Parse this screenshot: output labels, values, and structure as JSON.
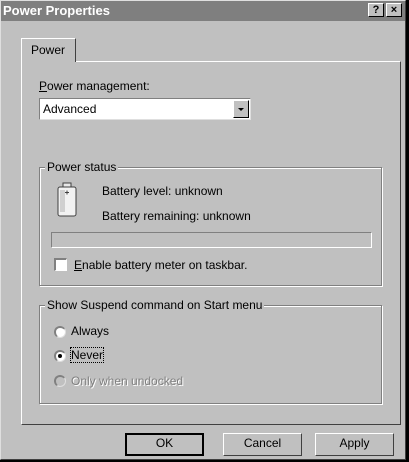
{
  "window": {
    "title": "Power Properties",
    "help_button": "?",
    "close_button": "×"
  },
  "tabs": [
    {
      "label": "Power",
      "selected": true
    }
  ],
  "power_management": {
    "label": "Power management:",
    "selected": "Advanced"
  },
  "power_status": {
    "legend": "Power status",
    "battery_level": "Battery level: unknown",
    "battery_remaining": "Battery remaining: unknown",
    "battery_meter_progress": 0,
    "enable_meter_label": "Enable battery meter on taskbar.",
    "enable_meter_checked": false
  },
  "suspend": {
    "legend": "Show Suspend command on Start menu",
    "options": [
      {
        "label": "Always",
        "selected": false,
        "enabled": true
      },
      {
        "label": "Never",
        "selected": true,
        "enabled": true
      },
      {
        "label": "Only when undocked",
        "selected": false,
        "enabled": false
      }
    ]
  },
  "buttons": {
    "ok": "OK",
    "cancel": "Cancel",
    "apply": "Apply"
  },
  "icons": {
    "battery": "battery-icon",
    "dropdown": "chevron-down-icon"
  }
}
